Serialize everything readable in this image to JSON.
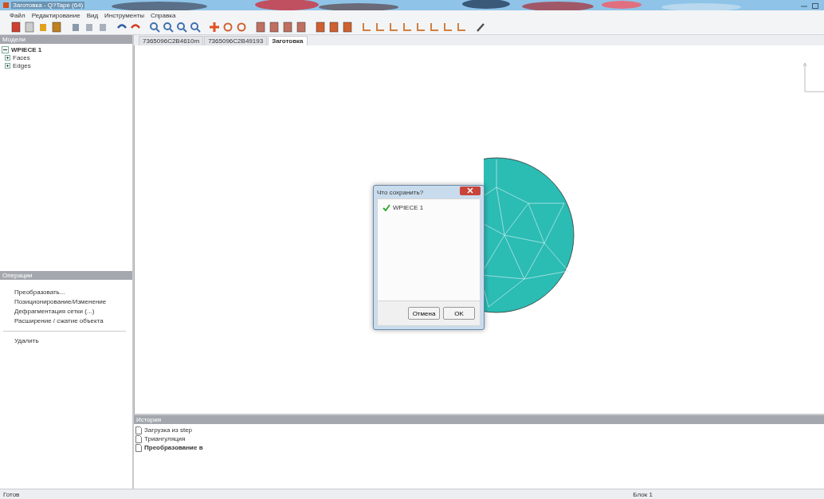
{
  "window": {
    "title": "Заготовка - Q?Tape (64)"
  },
  "menu": [
    "Файл",
    "Редактирование",
    "Вид",
    "Инструменты",
    "Справка"
  ],
  "models_panel": {
    "title": "Модели",
    "tree": [
      {
        "label": "WPIECE 1",
        "expanded": true,
        "children": [
          {
            "label": "Faces",
            "expanded": false
          },
          {
            "label": "Edges",
            "expanded": false
          }
        ]
      }
    ]
  },
  "operations_panel": {
    "title": "Операции",
    "items": [
      "Преобразовать...",
      "Позиционирование/Изменение",
      "Дефрагментация сетки (...)",
      "Расширение / сжатие объекта"
    ],
    "delete": "Удалить"
  },
  "tabs": [
    {
      "label": "7365096C2B4610m",
      "selected": false
    },
    {
      "label": "7365096C2B49193",
      "selected": false
    },
    {
      "label": "Заготовка",
      "selected": true
    }
  ],
  "dialog": {
    "title": "Что сохранить?",
    "items": [
      {
        "label": "WPIECE 1",
        "checked": true
      }
    ],
    "buttons": [
      "Отмена",
      "OK"
    ]
  },
  "history_panel": {
    "title": "История",
    "items": [
      {
        "label": "Загрузка из step",
        "current": false
      },
      {
        "label": "Триангуляция",
        "current": false
      },
      {
        "label": "Преобразование в",
        "current": true
      }
    ]
  },
  "status_bar": {
    "left": "Готов",
    "block": "Блок 1"
  }
}
